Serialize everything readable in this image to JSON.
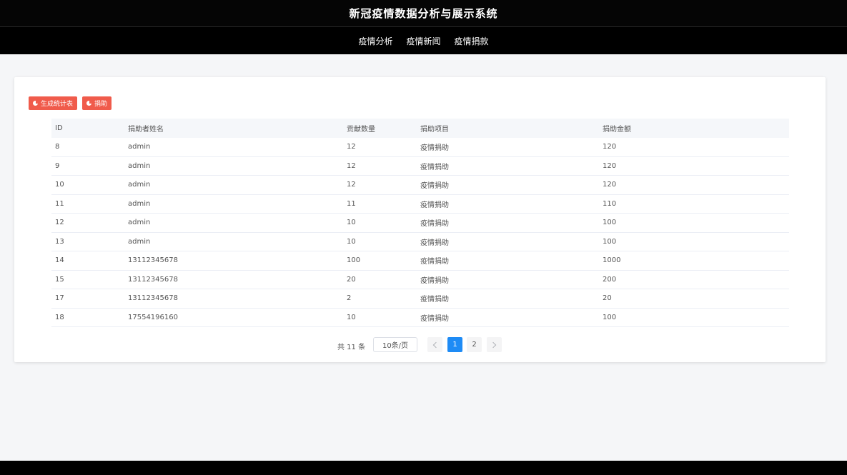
{
  "app": {
    "title": "新冠疫情数据分析与展示系统"
  },
  "nav": {
    "items": [
      "疫情分析",
      "疫情新闻",
      "疫情捐款"
    ]
  },
  "toolbar": {
    "stats_label": "生成统计表",
    "donate_label": "捐助"
  },
  "table": {
    "columns": [
      "ID",
      "捐助者姓名",
      "贡献数量",
      "捐助项目",
      "捐助金额"
    ],
    "rows": [
      [
        "8",
        "admin",
        "12",
        "疫情捐助",
        "120"
      ],
      [
        "9",
        "admin",
        "12",
        "疫情捐助",
        "120"
      ],
      [
        "10",
        "admin",
        "12",
        "疫情捐助",
        "120"
      ],
      [
        "11",
        "admin",
        "11",
        "疫情捐助",
        "110"
      ],
      [
        "12",
        "admin",
        "10",
        "疫情捐助",
        "100"
      ],
      [
        "13",
        "admin",
        "10",
        "疫情捐助",
        "100"
      ],
      [
        "14",
        "13112345678",
        "100",
        "疫情捐助",
        "1000"
      ],
      [
        "15",
        "13112345678",
        "20",
        "疫情捐助",
        "200"
      ],
      [
        "17",
        "13112345678",
        "2",
        "疫情捐助",
        "20"
      ],
      [
        "18",
        "17554196160",
        "10",
        "疫情捐助",
        "100"
      ]
    ]
  },
  "pagination": {
    "total_text": "共 11 条",
    "page_size": "10条/页",
    "pages": [
      "1",
      "2"
    ],
    "current": "1"
  },
  "colors": {
    "accent": "#f05b4b",
    "primary": "#1e8bf5",
    "header_bg": "#000000"
  }
}
